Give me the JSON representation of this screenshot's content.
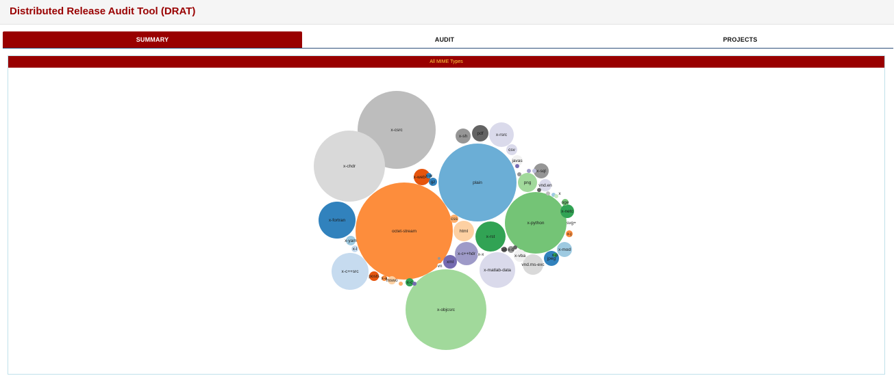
{
  "app": {
    "title": "Distributed Release Audit Tool (DRAT)"
  },
  "tabs": [
    {
      "label": "SUMMARY",
      "active": true
    },
    {
      "label": "AUDIT",
      "active": false
    },
    {
      "label": "PROJECTS",
      "active": false
    }
  ],
  "panel": {
    "heading": "All MIME Types"
  },
  "colors": {
    "brand": "#990000",
    "heading_text": "#ffd23f",
    "tab_underline": "#2e4f7a"
  },
  "chart_data": {
    "type": "bubble",
    "title": "All MIME Types",
    "bubbles": [
      {
        "label": "octet-stream",
        "color": "#fd8d3c"
      },
      {
        "label": "plain",
        "color": "#6baed6"
      },
      {
        "label": "x-objcsrc",
        "color": "#a1d99b"
      },
      {
        "label": "x-csrc",
        "color": "#bdbdbd"
      },
      {
        "label": "x-chdr",
        "color": "#d9d9d9"
      },
      {
        "label": "x-python",
        "color": "#74c476"
      },
      {
        "label": "x-c++src",
        "color": "#c6dbef"
      },
      {
        "label": "x-fortran",
        "color": "#3182bd"
      },
      {
        "label": "x-matlab-data",
        "color": "#dadaeb"
      },
      {
        "label": "x-rst",
        "color": "#31a354"
      },
      {
        "label": "x-rsrc",
        "color": "#dadaeb"
      },
      {
        "label": "x-c++hdr",
        "color": "#9e9ac8"
      },
      {
        "label": "html",
        "color": "#fdd0a2"
      },
      {
        "label": "vnd.ms-exc",
        "color": "#d9d9d9"
      },
      {
        "label": "png",
        "color": "#a1d99b"
      },
      {
        "label": "x-web-m",
        "color": "#e6550d"
      },
      {
        "label": "pdf",
        "color": "#636363"
      },
      {
        "label": "x-sh",
        "color": "#969696"
      },
      {
        "label": "x-sql",
        "color": "#969696"
      },
      {
        "label": "xml",
        "color": "#756bb1"
      },
      {
        "label": "jpeg",
        "color": "#3182bd"
      },
      {
        "label": "x-mod",
        "color": "#9ecae1"
      },
      {
        "label": "x-netc",
        "color": "#31a354"
      },
      {
        "label": "vnd.en",
        "color": "#dadaeb"
      },
      {
        "label": "csv",
        "color": "#dadaeb"
      },
      {
        "label": "x-vba",
        "color": "#f0f0f0"
      },
      {
        "label": "x-yam",
        "color": "#9ecae1"
      },
      {
        "label": "javas",
        "color": "#f2f2f2"
      },
      {
        "label": "posts",
        "color": "#e6550d"
      },
      {
        "label": "css",
        "color": "#fdae6b"
      },
      {
        "label": "svg+",
        "color": "#ffffff"
      },
      {
        "label": "x-l",
        "color": "#c6dbef"
      },
      {
        "label": "x-c",
        "color": "#31a354"
      },
      {
        "label": "x-j",
        "color": "#fd8d3c"
      },
      {
        "label": "x-x",
        "color": "#ffffff"
      },
      {
        "label": "vn",
        "color": "#ffffff"
      },
      {
        "label": "mswo",
        "color": "#fdd0a2"
      },
      {
        "label": "x-b",
        "color": "#969696"
      },
      {
        "label": "gz",
        "color": "#3182bd"
      },
      {
        "label": "oge",
        "color": "#74c476"
      },
      {
        "label": "x-a",
        "color": "#fd8d3c"
      },
      {
        "label": "x",
        "color": "#ffffff"
      },
      {
        "label": "x-w",
        "color": "#3182bd"
      },
      {
        "label": "x-p",
        "color": "#31a354"
      },
      {
        "label": "tab",
        "color": "#636363"
      },
      {
        "label": "",
        "color": "#756bb1"
      },
      {
        "label": "",
        "color": "#9e9ac8"
      },
      {
        "label": "",
        "color": "#bcbddc"
      },
      {
        "label": "",
        "color": "#636363"
      },
      {
        "label": "",
        "color": "#969696"
      },
      {
        "label": "",
        "color": "#bdbdbd"
      },
      {
        "label": "",
        "color": "#9ecae1"
      },
      {
        "label": "",
        "color": "#c7e9c0"
      },
      {
        "label": "",
        "color": "#74c476"
      },
      {
        "label": "",
        "color": "#636363"
      },
      {
        "label": "",
        "color": "#fdae6b"
      },
      {
        "label": "",
        "color": "#756bb1"
      },
      {
        "label": "",
        "color": "#969696"
      }
    ]
  }
}
